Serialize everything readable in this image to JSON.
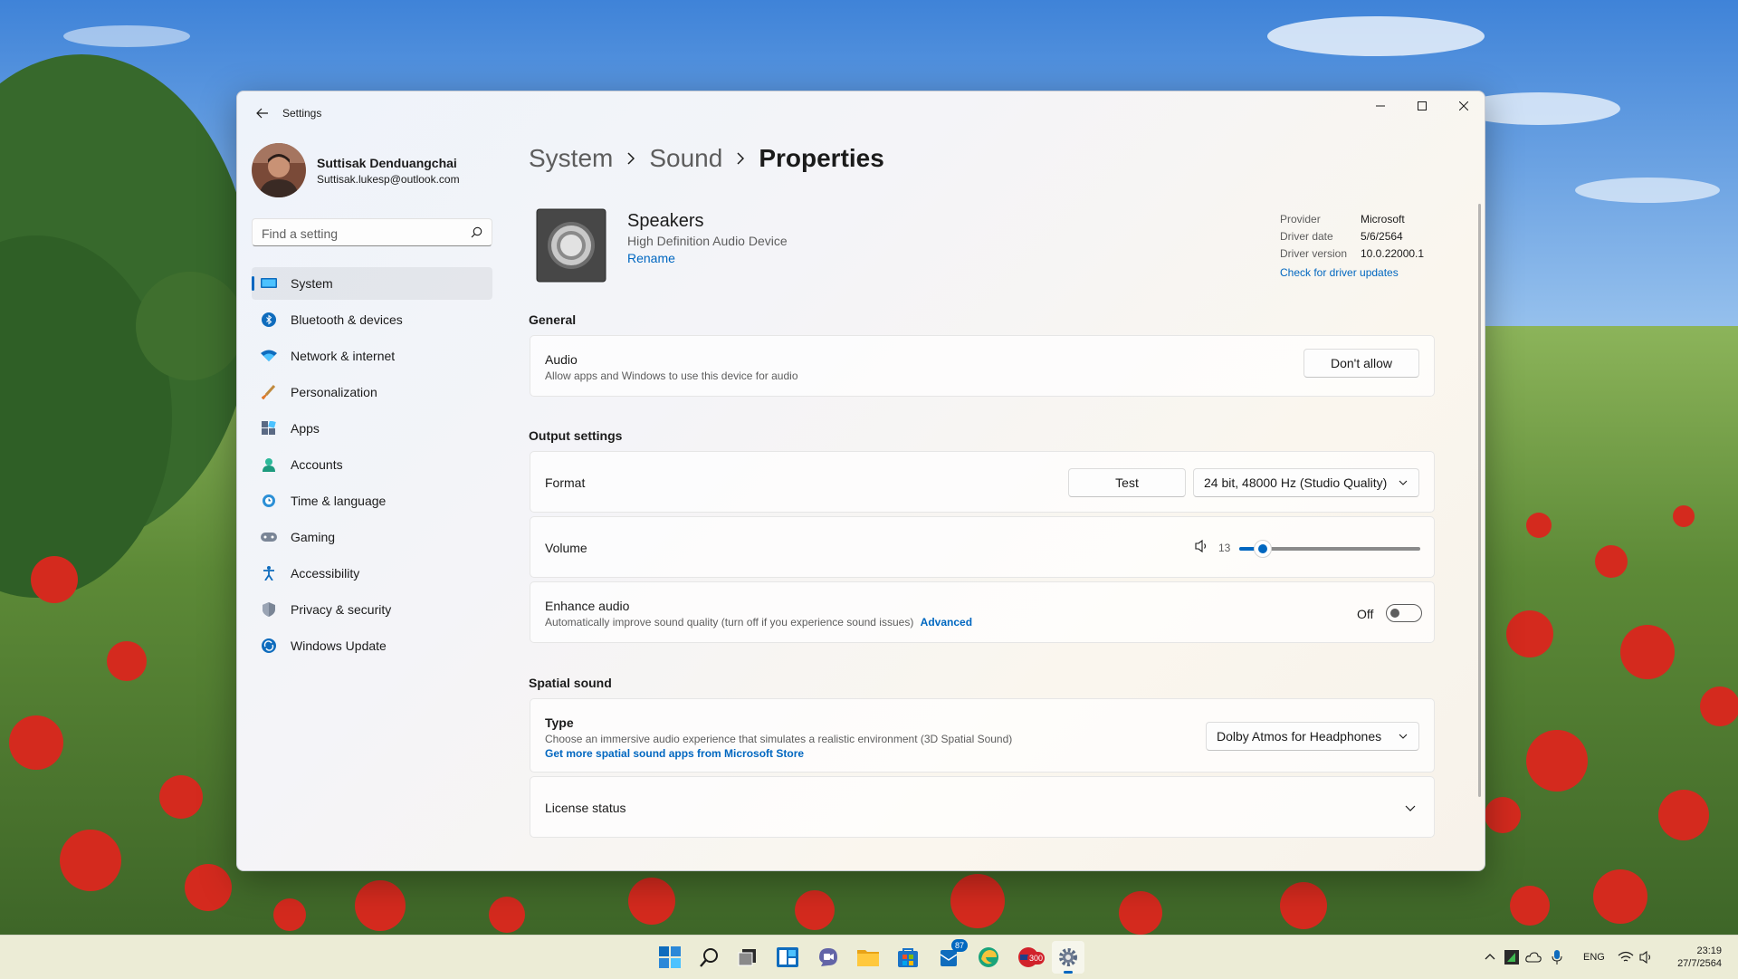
{
  "window": {
    "title": "Settings"
  },
  "user": {
    "name": "Suttisak Denduangchai",
    "email": "Suttisak.lukesp@outlook.com"
  },
  "search": {
    "placeholder": "Find a setting"
  },
  "nav": {
    "items": [
      {
        "label": "System",
        "icon": "system-icon",
        "active": true
      },
      {
        "label": "Bluetooth & devices",
        "icon": "bluetooth-icon"
      },
      {
        "label": "Network & internet",
        "icon": "wifi-icon"
      },
      {
        "label": "Personalization",
        "icon": "brush-icon"
      },
      {
        "label": "Apps",
        "icon": "apps-icon"
      },
      {
        "label": "Accounts",
        "icon": "accounts-icon"
      },
      {
        "label": "Time & language",
        "icon": "globe-clock-icon"
      },
      {
        "label": "Gaming",
        "icon": "gamepad-icon"
      },
      {
        "label": "Accessibility",
        "icon": "accessibility-icon"
      },
      {
        "label": "Privacy & security",
        "icon": "shield-icon"
      },
      {
        "label": "Windows Update",
        "icon": "update-icon"
      }
    ]
  },
  "breadcrumb": {
    "items": [
      "System",
      "Sound",
      "Properties"
    ]
  },
  "device": {
    "name": "Speakers",
    "description": "High Definition Audio Device",
    "rename_label": "Rename",
    "driver": {
      "provider_label": "Provider",
      "provider": "Microsoft",
      "date_label": "Driver date",
      "date": "5/6/2564",
      "version_label": "Driver version",
      "version": "10.0.22000.1",
      "update_link": "Check for driver updates"
    }
  },
  "general": {
    "title": "General",
    "audio": {
      "title": "Audio",
      "subtitle": "Allow apps and Windows to use this device for audio",
      "button": "Don't allow"
    }
  },
  "output": {
    "title": "Output settings",
    "format": {
      "label": "Format",
      "test_button": "Test",
      "selected": "24 bit, 48000 Hz (Studio Quality)"
    },
    "volume": {
      "label": "Volume",
      "value": "13",
      "level_percent": 13
    },
    "enhance": {
      "title": "Enhance audio",
      "subtitle": "Automatically improve sound quality (turn off if you experience sound issues)",
      "advanced_link": "Advanced",
      "state": "Off"
    }
  },
  "spatial": {
    "title": "Spatial sound",
    "type": {
      "title": "Type",
      "subtitle": "Choose an immersive audio experience that simulates a realistic environment (3D Spatial Sound)",
      "store_link": "Get more spatial sound apps from Microsoft Store",
      "selected": "Dolby Atmos for Headphones"
    },
    "license": {
      "title": "License status"
    }
  },
  "taskbar": {
    "apps": [
      {
        "name": "start"
      },
      {
        "name": "search"
      },
      {
        "name": "task-view"
      },
      {
        "name": "widgets"
      },
      {
        "name": "chat"
      },
      {
        "name": "file-explorer"
      },
      {
        "name": "store"
      },
      {
        "name": "mail",
        "badge": "87"
      },
      {
        "name": "edge-canary"
      },
      {
        "name": "red-app",
        "badge": "300"
      },
      {
        "name": "settings",
        "active": true
      }
    ],
    "language": "ENG",
    "time": "23:19",
    "date": "27/7/2564"
  },
  "colors": {
    "accent": "#0067c0",
    "text": "#1b1b1b",
    "secondary_text": "#5d5d5d"
  }
}
